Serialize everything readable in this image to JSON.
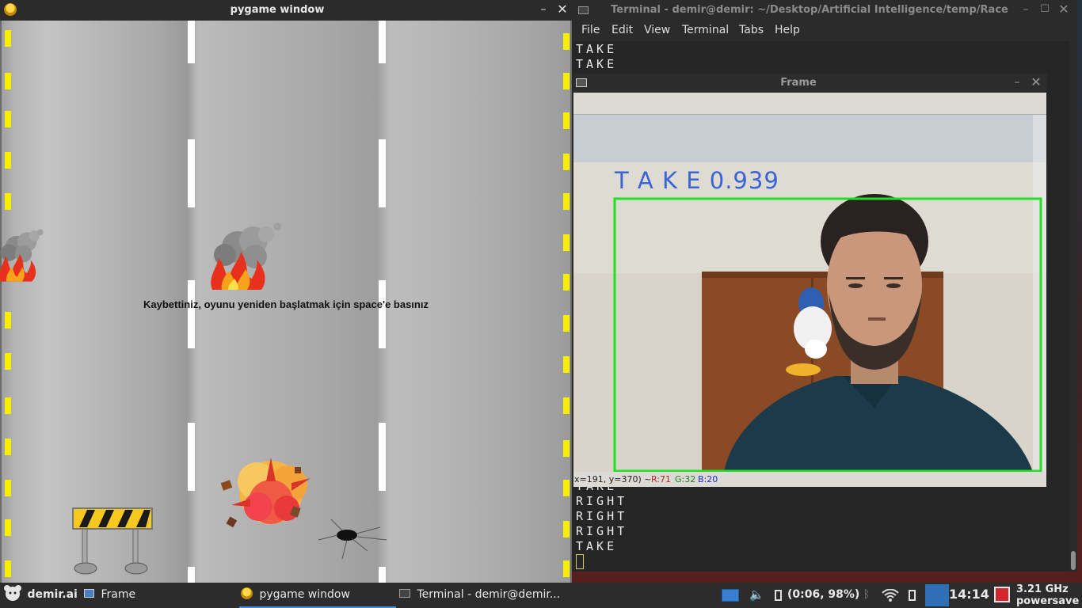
{
  "pygame": {
    "title": "pygame window",
    "message": "Kaybettiniz, oyunu yeniden başlatmak için space'e basınız"
  },
  "terminal": {
    "title": "Terminal - demir@demir: ~/Desktop/Artificial Intelligence/temp/Race",
    "menu": [
      "File",
      "Edit",
      "View",
      "Terminal",
      "Tabs",
      "Help"
    ],
    "lines_top": [
      "TAKE",
      "TAKE"
    ],
    "lines_bottom": [
      "TAKE",
      "RIGHT",
      "RIGHT",
      "RIGHT",
      "TAKE"
    ]
  },
  "frame": {
    "title": "Frame",
    "overlay_text": "T A K E 0.939",
    "status": {
      "coords": "x=191, y=370) ~",
      "r": "R:71",
      "g": "G:32",
      "b": "B:20"
    }
  },
  "taskbar": {
    "menu_label": "demir.ai",
    "tasks": [
      "Frame",
      "pygame window",
      "Terminal - demir@demir..."
    ],
    "battery": "(0:06, 98%)",
    "clock": "14:14",
    "cpu_freq": "3.21 GHz",
    "cpu_governor": "powersave"
  },
  "icons": {
    "pygame_app": "pygame-snake-icon",
    "terminal_app": "terminal-icon",
    "frame_app": "window-icon",
    "bluetooth": "bluetooth-icon",
    "wifi": "wifi-icon",
    "volume": "volume-icon",
    "battery": "battery-icon"
  },
  "colors": {
    "bbox": "#22e022",
    "overlay_text": "#3a63d6",
    "edge_yellow": "#f7ee00"
  }
}
